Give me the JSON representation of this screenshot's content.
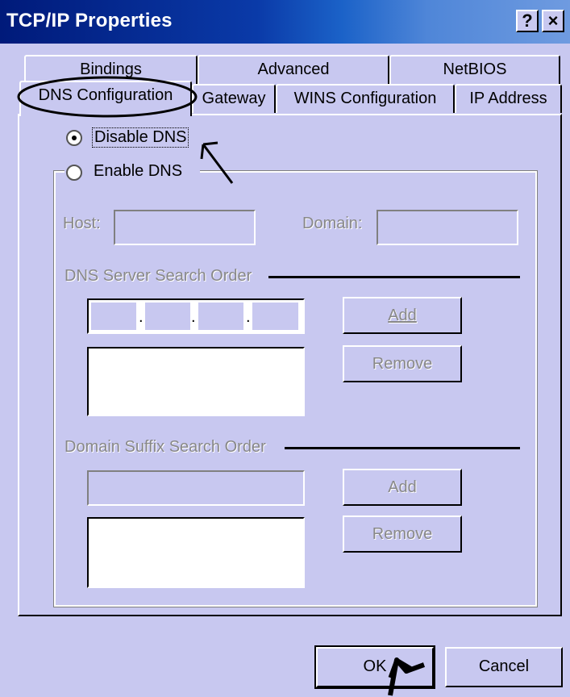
{
  "window": {
    "title": "TCP/IP Properties",
    "help_glyph": "?",
    "close_glyph": "×"
  },
  "tabs": {
    "row_back": [
      "Bindings",
      "Advanced",
      "NetBIOS"
    ],
    "row_front": [
      "DNS Configuration",
      "Gateway",
      "WINS Configuration",
      "IP Address"
    ],
    "active": "DNS Configuration"
  },
  "dns": {
    "disable_label": "Disable DNS",
    "disable_selected": true,
    "enable_label": "Enable DNS",
    "enable_selected": false,
    "host_label": "Host:",
    "domain_label": "Domain:",
    "server_section": "DNS Server Search Order",
    "suffix_section": "Domain Suffix Search Order",
    "add_label": "Add",
    "remove_label": "Remove",
    "ip_dots": [
      ".",
      ".",
      "."
    ]
  },
  "buttons": {
    "ok": "OK",
    "cancel": "Cancel"
  }
}
